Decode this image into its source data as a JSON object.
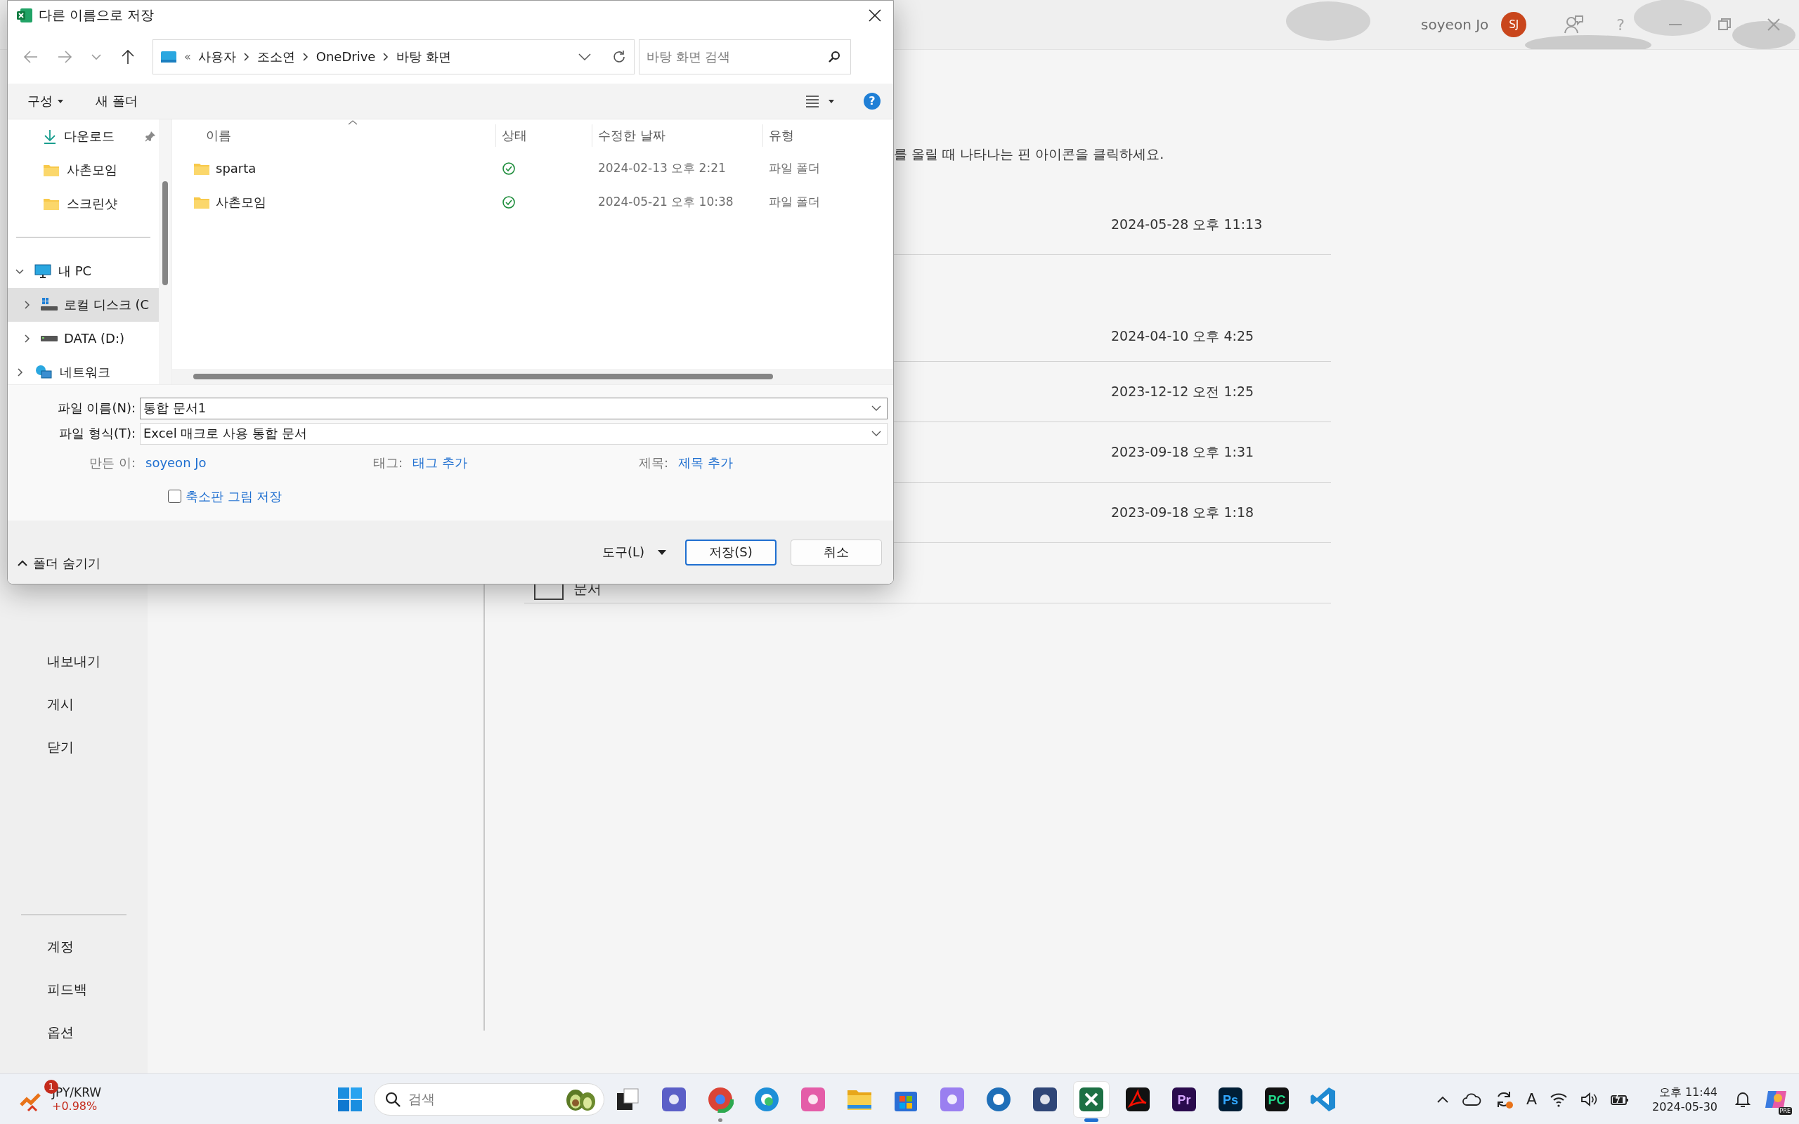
{
  "excel": {
    "title_bar": {
      "user_name": "soyeon Jo",
      "avatar_initials": "SJ",
      "help": "?"
    },
    "nav": {
      "items": [
        {
          "label": "내보내기"
        },
        {
          "label": "게시"
        },
        {
          "label": "닫기"
        }
      ],
      "bottom_items": [
        {
          "label": "계정"
        },
        {
          "label": "피드백"
        },
        {
          "label": "옵션"
        }
      ]
    },
    "pin_hint": "를 올릴 때 나타나는 핀 아이콘을 클릭하세요.",
    "recent_rows": [
      {
        "date": "2024-05-28 오후 11:13"
      },
      {
        "date": "2024-04-10 오후 4:25"
      },
      {
        "date": "2023-12-12 오전 1:25"
      },
      {
        "date": "2023-09-18 오후 1:31"
      },
      {
        "date": "2023-09-18 오후 1:18"
      },
      {
        "name": "문서"
      }
    ]
  },
  "dialog": {
    "title": "다른 이름으로 저장",
    "address": {
      "overflow": "«",
      "breadcrumbs": [
        "사용자",
        "조소연",
        "OneDrive",
        "바탕 화면"
      ]
    },
    "search": {
      "placeholder": "바탕 화면 검색"
    },
    "toolbar": {
      "organize": "구성",
      "new_folder": "새 폴더",
      "help": "?"
    },
    "quick_access": [
      {
        "label": "다운로드",
        "kind": "download",
        "pinned": true
      },
      {
        "label": "사촌모임",
        "kind": "folder",
        "pinned": false
      },
      {
        "label": "스크린샷",
        "kind": "folder",
        "pinned": false
      }
    ],
    "tree": [
      {
        "label": "내 PC",
        "kind": "pc",
        "expanded": true,
        "selected": false,
        "children": [
          {
            "label": "로컬 디스크 (C",
            "kind": "windows-drive",
            "expanded": false,
            "selected": true
          },
          {
            "label": "DATA (D:)",
            "kind": "drive",
            "expanded": false,
            "selected": false
          }
        ]
      },
      {
        "label": "네트워크",
        "kind": "network",
        "expanded": false,
        "selected": false
      }
    ],
    "columns": [
      "이름",
      "상태",
      "수정한 날짜",
      "유형"
    ],
    "files": [
      {
        "name": "sparta",
        "synced": true,
        "modified": "2024-02-13 오후 2:21",
        "type": "파일 폴더"
      },
      {
        "name": "사촌모임",
        "synced": true,
        "modified": "2024-05-21 오후 10:38",
        "type": "파일 폴더"
      }
    ],
    "file_name": {
      "label": "파일 이름(N):",
      "value": "통합 문서1"
    },
    "file_type": {
      "label": "파일 형식(T):",
      "value": "Excel 매크로 사용 통합 문서"
    },
    "meta": [
      {
        "label": "만든 이:",
        "value": "soyeon Jo"
      },
      {
        "label": "태그:",
        "value": "태그 추가"
      },
      {
        "label": "제목:",
        "value": "제목 추가"
      }
    ],
    "thumbnail": {
      "label": "축소판 그림 저장",
      "checked": false
    },
    "hide_folders": "폴더 숨기기",
    "tools": "도구(L)",
    "save": "저장(S)",
    "cancel": "취소"
  },
  "taskbar": {
    "widget": {
      "badge": "1",
      "pair": "JPY/KRW",
      "change": "+0.98%"
    },
    "search": {
      "placeholder": "검색"
    },
    "apps": [
      {
        "kind": "task-view",
        "running": false,
        "active": false
      },
      {
        "kind": "teams",
        "running": false,
        "active": false
      },
      {
        "kind": "chrome",
        "running": true,
        "active": false
      },
      {
        "kind": "edge",
        "running": false,
        "active": false
      },
      {
        "kind": "idea",
        "running": false,
        "active": false
      },
      {
        "kind": "explorer",
        "running": false,
        "active": false
      },
      {
        "kind": "store",
        "running": false,
        "active": false
      },
      {
        "kind": "notes",
        "running": false,
        "active": false
      },
      {
        "kind": "ring",
        "running": false,
        "active": false
      },
      {
        "kind": "remote",
        "running": false,
        "active": false
      },
      {
        "kind": "excel",
        "running": true,
        "active": true
      },
      {
        "kind": "acrobat",
        "running": false,
        "active": false
      },
      {
        "kind": "premiere",
        "glyph": "Pr",
        "running": false,
        "active": false
      },
      {
        "kind": "photoshop",
        "glyph": "Ps",
        "running": false,
        "active": false
      },
      {
        "kind": "pycharm",
        "glyph": "PC",
        "running": false,
        "active": false
      },
      {
        "kind": "vscode",
        "running": false,
        "active": false
      }
    ],
    "tray": {
      "language": "A",
      "time": "오후 11:44",
      "date": "2024-05-30",
      "copilot_badge": "PRE"
    }
  }
}
